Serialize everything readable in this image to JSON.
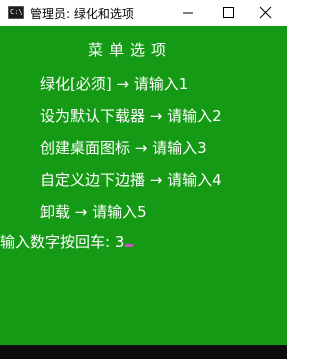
{
  "window": {
    "icon_text": "C:\\",
    "title": "管理员: 绿化和选项"
  },
  "console": {
    "menu_title": "菜单选项",
    "items": [
      "绿化[必须] → 请输入1",
      "设为默认下载器 → 请输入2",
      "创建桌面图标 → 请输入3",
      "自定义边下边播 → 请输入4",
      "卸载 → 请输入5"
    ],
    "prompt": "输入数字按回车: 3"
  },
  "colors": {
    "console_bg": "#159a15",
    "console_text": "#ffffff",
    "cursor": "#d050d0"
  },
  "icons": {
    "minimize": "minimize-icon",
    "maximize": "maximize-icon",
    "close": "close-icon",
    "app": "console-app-icon"
  }
}
